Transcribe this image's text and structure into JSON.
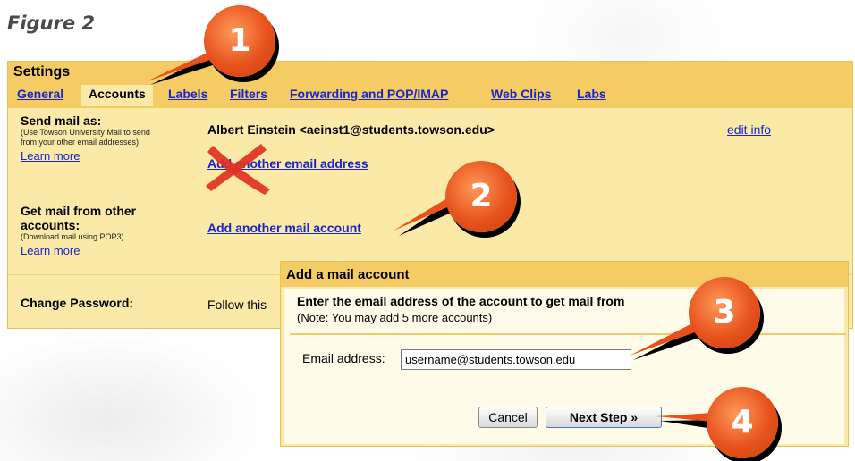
{
  "figure_label": "Figure 2",
  "settings": {
    "title": "Settings",
    "tabs": [
      {
        "label": "General",
        "active": false
      },
      {
        "label": "Accounts",
        "active": true
      },
      {
        "label": "Labels",
        "active": false
      },
      {
        "label": "Filters",
        "active": false
      },
      {
        "label": "Forwarding and POP/IMAP",
        "active": false
      },
      {
        "label": "Web Clips",
        "active": false
      },
      {
        "label": "Labs",
        "active": false
      }
    ],
    "send_mail": {
      "label": "Send mail as:",
      "sub": "(Use Towson University Mail to send from your other email addresses)",
      "learn_more": "Learn more",
      "identity": "Albert Einstein <aeinst1@students.towson.edu>",
      "add_address_link": "Add another email address",
      "edit_info": "edit info"
    },
    "get_mail": {
      "label": "Get mail from other accounts:",
      "sub": "(Download mail using POP3)",
      "learn_more": "Learn more",
      "add_account_link": "Add another mail account"
    },
    "change_password": {
      "label": "Change Password:",
      "value": "Follow this"
    }
  },
  "dialog": {
    "title": "Add a mail account",
    "heading": "Enter the email address of the account to get mail from",
    "note": "(Note: You may add 5 more accounts)",
    "email_label": "Email address:",
    "email_value": "username@students.towson.edu",
    "cancel_label": "Cancel",
    "next_label": "Next Step »"
  },
  "callouts": [
    "1",
    "2",
    "3",
    "4"
  ],
  "colors": {
    "header_bg": "#f4cc63",
    "panel_bg": "#fbe9a7",
    "link": "#1a25c9",
    "callout": "#e7521c",
    "cross": "#e0311f"
  },
  "icons": {
    "cross_mark": "x-mark-icon"
  }
}
